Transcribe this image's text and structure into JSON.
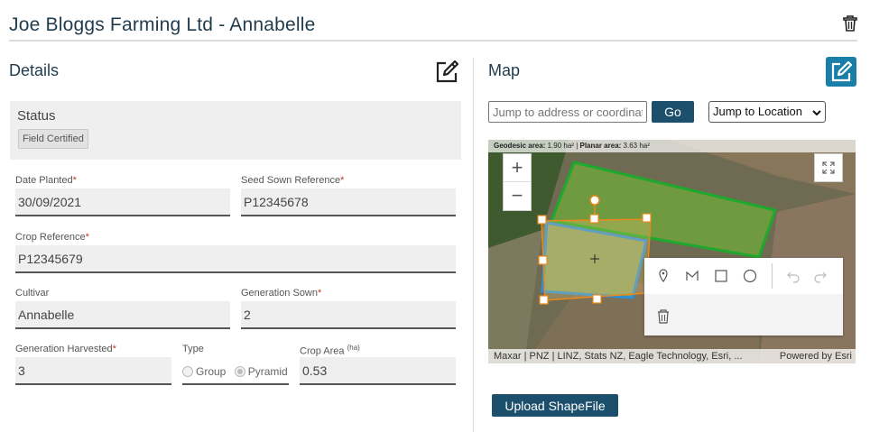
{
  "header": {
    "title": "Joe Bloggs Farming Ltd - Annabelle"
  },
  "details": {
    "title": "Details",
    "status": {
      "label": "Status",
      "badge": "Field Certified"
    },
    "date_planted": {
      "label": "Date Planted",
      "value": "30/09/2021"
    },
    "seed_sown_reference": {
      "label": "Seed Sown Reference",
      "value": "P12345678"
    },
    "crop_reference": {
      "label": "Crop Reference",
      "value": "P12345679"
    },
    "cultivar": {
      "label": "Cultivar",
      "value": "Annabelle"
    },
    "generation_sown": {
      "label": "Generation Sown",
      "value": "2"
    },
    "generation_harvested": {
      "label": "Generation Harvested",
      "value": "3"
    },
    "type": {
      "label": "Type",
      "options": [
        "Group",
        "Pyramid"
      ],
      "selected": "Pyramid"
    },
    "crop_area": {
      "label": "Crop Area",
      "unit": "(ha)",
      "value": "0.53"
    }
  },
  "map": {
    "title": "Map",
    "search": {
      "placeholder": "Jump to address or coordinates",
      "go_label": "Go"
    },
    "jump_to_location": "Jump to Location",
    "area_bar": {
      "geodesic_label": "Geodesic area:",
      "geodesic_value": "1.90 ha²",
      "sep": " | ",
      "planar_label": "Planar area:",
      "planar_value": "3.63 ha²"
    },
    "attribution": "Maxar | PNZ | LINZ, Stats NZ, Eagle Technology, Esri, ...",
    "powered_by": "Powered by Esri",
    "upload_label": "Upload ShapeFile"
  },
  "colors": {
    "accent": "#1b4f6b",
    "edit_button": "#1a7fa8",
    "required": "#c0392b",
    "title": "#1f3b4d"
  }
}
